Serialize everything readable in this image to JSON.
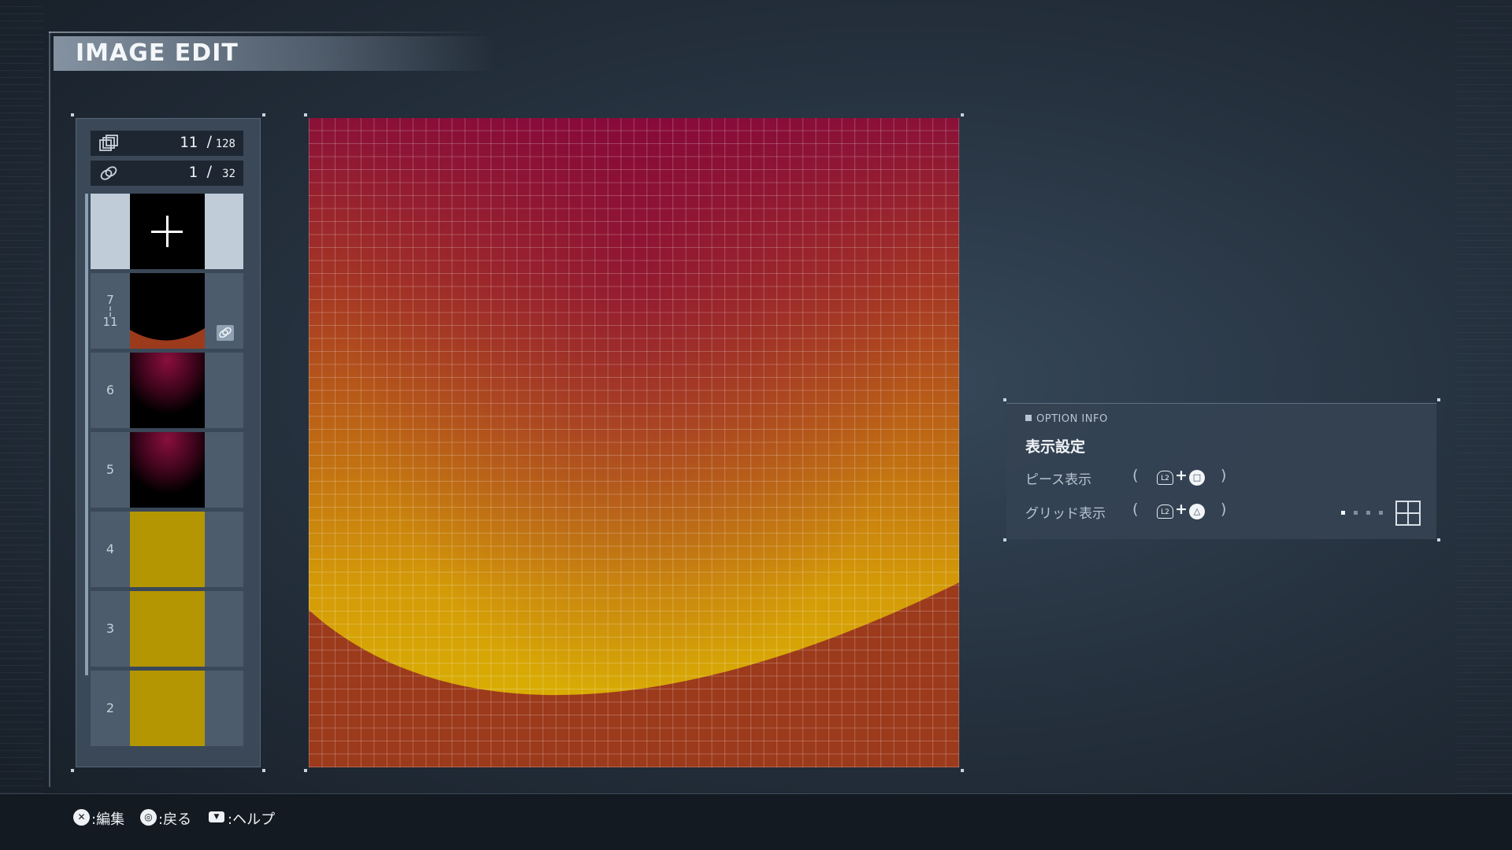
{
  "header": {
    "title": "IMAGE EDIT"
  },
  "counters": [
    {
      "icon": "layers-icon",
      "current": "11",
      "separator": "/",
      "max": "128"
    },
    {
      "icon": "link-icon",
      "current": "1",
      "separator": "/",
      "max": "32"
    }
  ],
  "layers": [
    {
      "label": "",
      "type": "add"
    },
    {
      "label": "7\n¦\n11",
      "type": "group",
      "linked": true
    },
    {
      "label": "6",
      "type": "gradient"
    },
    {
      "label": "5",
      "type": "gradient"
    },
    {
      "label": "4",
      "type": "solid"
    },
    {
      "label": "3",
      "type": "solid"
    },
    {
      "label": "2",
      "type": "solid"
    }
  ],
  "option_info": {
    "heading": "OPTION INFO",
    "title": "表示設定",
    "rows": [
      {
        "label": "ピース表示",
        "open": "(",
        "button1": "L2",
        "plus": "+",
        "button2": "□",
        "close": ")"
      },
      {
        "label": "グリッド表示",
        "open": "(",
        "button1": "L2",
        "plus": "+",
        "button2": "△",
        "close": ")"
      }
    ],
    "grid_level": "1/4"
  },
  "footer": {
    "hints": [
      {
        "button": "✕",
        "label": ":編集"
      },
      {
        "button": "◎",
        "label": ":戻る"
      },
      {
        "button": "▼",
        "label": ":ヘルプ"
      }
    ]
  },
  "colors": {
    "canvas_top": "#8a1038",
    "canvas_mid": "#bf6a14",
    "canvas_bottom": "#d9ae04",
    "lower_shape": "#9c3a1c",
    "solid_layer": "#b49502"
  }
}
